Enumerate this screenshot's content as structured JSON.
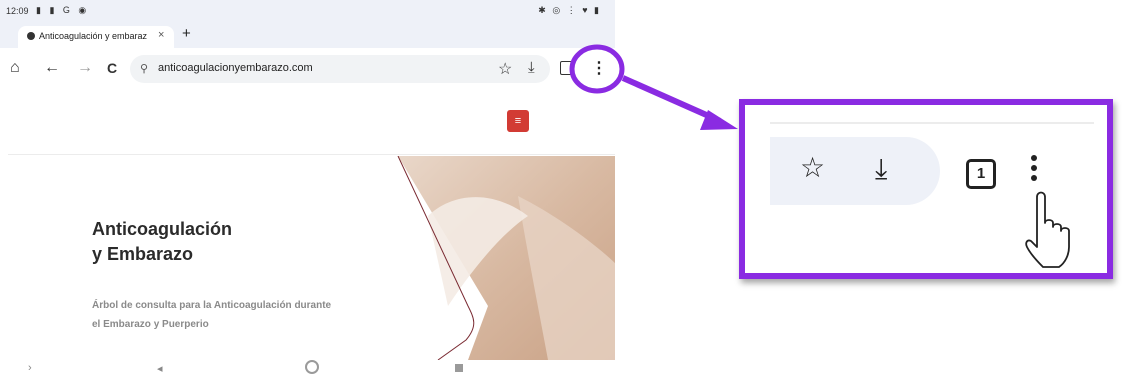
{
  "status_bar": {
    "time": "12:09",
    "left_icons": "▮ ▮ G ◉",
    "right_icons": "✱ ◎ ⋮ ♥ ▮"
  },
  "tab": {
    "title": "Anticoagulación y embaraz",
    "close_glyph": "×",
    "new_tab_glyph": "+"
  },
  "toolbar": {
    "home_glyph": "⌂",
    "back_glyph": "←",
    "forward_glyph": "→",
    "reload_glyph": "C",
    "site_info_glyph": "⚲",
    "url": "anticoagulacionyembarazo.com",
    "bookmark_glyph": "☆",
    "download_glyph": "⤓",
    "menu_glyph": "⋮"
  },
  "page": {
    "menu_button_glyph": "≡",
    "hero_title_line1": "Anticoagulación",
    "hero_title_line2": "y Embarazo",
    "hero_subtitle_line1": "Árbol de consulta para la Anticoagulación durante",
    "hero_subtitle_line2": "el Embarazo y Puerperio"
  },
  "navbar": {
    "back_glyph": "›",
    "triangle_glyph": "◂"
  },
  "zoom": {
    "bookmark_glyph": "☆",
    "download_glyph": "⤓",
    "tab_count": "1"
  },
  "colors": {
    "callout_accent": "#8a2be2",
    "menu_button": "#d23b34",
    "toolbar_pill": "#eef1f8"
  }
}
